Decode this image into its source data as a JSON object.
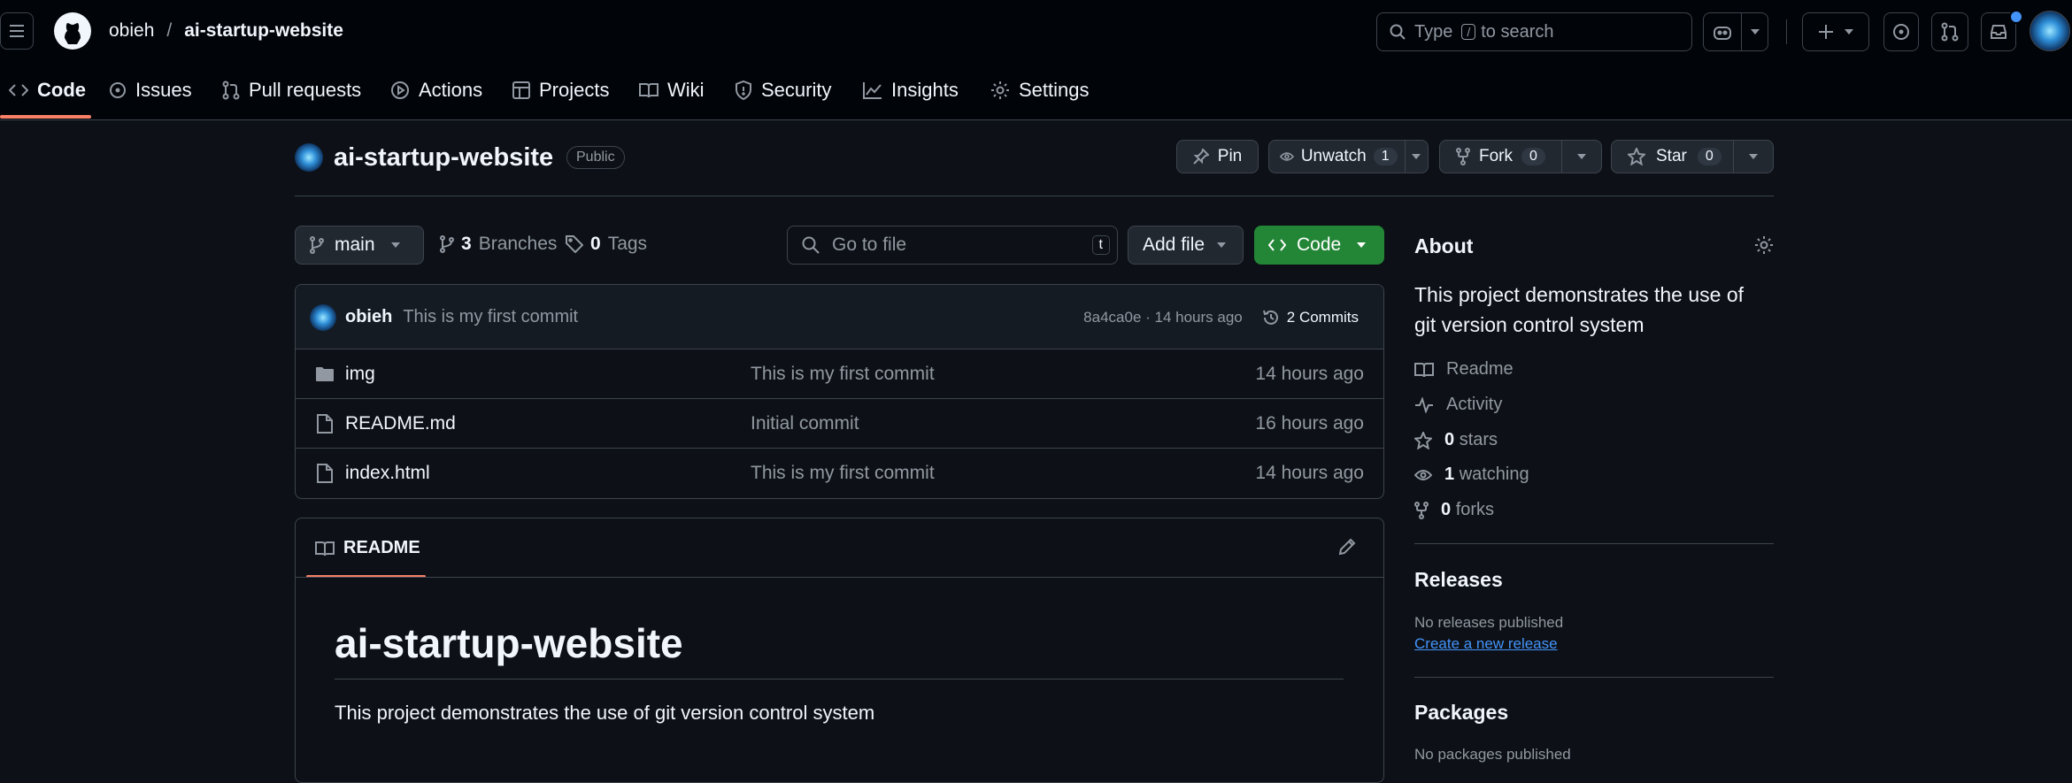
{
  "header": {
    "owner": "obieh",
    "separator": "/",
    "repo": "ai-startup-website",
    "search_prefix": "Type",
    "search_key": "/",
    "search_suffix": "to search"
  },
  "nav": {
    "tabs": [
      {
        "label": "Code",
        "icon": "code-icon"
      },
      {
        "label": "Issues",
        "icon": "issue-icon"
      },
      {
        "label": "Pull requests",
        "icon": "pull-request-icon"
      },
      {
        "label": "Actions",
        "icon": "play-icon"
      },
      {
        "label": "Projects",
        "icon": "table-icon"
      },
      {
        "label": "Wiki",
        "icon": "book-icon"
      },
      {
        "label": "Security",
        "icon": "shield-icon"
      },
      {
        "label": "Insights",
        "icon": "graph-icon"
      },
      {
        "label": "Settings",
        "icon": "gear-icon"
      }
    ]
  },
  "repo": {
    "name": "ai-startup-website",
    "visibility": "Public",
    "pin_label": "Pin",
    "unwatch_label": "Unwatch",
    "watch_count": "1",
    "fork_label": "Fork",
    "fork_count": "0",
    "star_label": "Star",
    "star_count": "0"
  },
  "toolbar": {
    "branch": "main",
    "branches_count": "3",
    "branches_label": "Branches",
    "tags_count": "0",
    "tags_label": "Tags",
    "goto_placeholder": "Go to file",
    "goto_key": "t",
    "add_file_label": "Add file",
    "code_label": "Code"
  },
  "commit": {
    "author": "obieh",
    "message": "This is my first commit",
    "meta": "8a4ca0e · 14 hours ago",
    "commits_label": "2 Commits"
  },
  "files": [
    {
      "name": "img",
      "type": "folder",
      "message": "This is my first commit",
      "time": "14 hours ago"
    },
    {
      "name": "README.md",
      "type": "file",
      "message": "Initial commit",
      "time": "16 hours ago"
    },
    {
      "name": "index.html",
      "type": "file",
      "message": "This is my first commit",
      "time": "14 hours ago"
    }
  ],
  "readme": {
    "tab_label": "README",
    "title": "ai-startup-website",
    "body": "This project demonstrates the use of git version control system"
  },
  "about": {
    "heading": "About",
    "description": "This project demonstrates the use of git version control system",
    "readme_label": "Readme",
    "activity_label": "Activity",
    "stars_count": "0",
    "stars_label": "stars",
    "watching_count": "1",
    "watching_label": "watching",
    "forks_count": "0",
    "forks_label": "forks"
  },
  "releases": {
    "heading": "Releases",
    "empty_text": "No releases published",
    "create_link": "Create a new release"
  },
  "packages": {
    "heading": "Packages",
    "empty_text": "No packages published"
  },
  "colors": {
    "background": "#0d1117",
    "header_bg": "#010409",
    "accent_underline": "#f78166",
    "code_button": "#238636",
    "link": "#4493f8"
  }
}
